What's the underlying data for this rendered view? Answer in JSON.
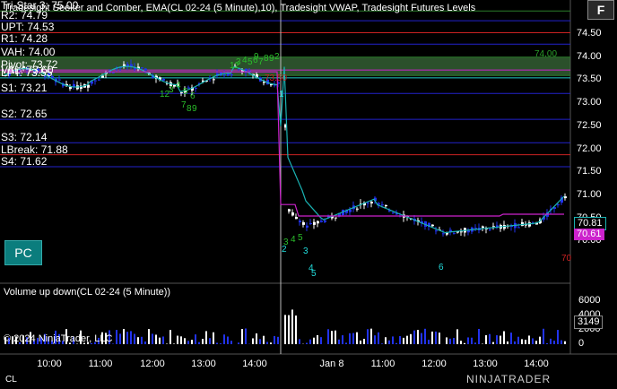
{
  "legend": "Tradesight Seeker and Comber, EMA(CL 02-24 (5 Minute),10), Tradesight VWAP, Tradesight Futures Levels",
  "levels": [
    {
      "label": "Tri-Star 3: 75.00",
      "price": 75.0,
      "color": "#2a7d2a"
    },
    {
      "label": "R2: 74.79",
      "price": 74.79,
      "color": "#2222cc"
    },
    {
      "label": "UPT: 74.53",
      "price": 74.53,
      "color": "#cc2222"
    },
    {
      "label": "R1: 74.28",
      "price": 74.28,
      "color": "#2222cc"
    },
    {
      "label": "VAH: 74.00",
      "price": 74.0,
      "color": "#2a7d2a"
    },
    {
      "label": "Pivot: 73.72",
      "price": 73.72,
      "color": "#cc22cc"
    },
    {
      "label": "VAL: 73.60",
      "price": 73.6,
      "color": "#2a7d2a"
    },
    {
      "label": "LPT: 73.55",
      "price": 73.55,
      "color": "#22cccc"
    },
    {
      "label": "S1: 73.21",
      "price": 73.21,
      "color": "#2222cc"
    },
    {
      "label": "S2: 72.65",
      "price": 72.65,
      "color": "#2222cc"
    },
    {
      "label": "S3: 72.14",
      "price": 72.14,
      "color": "#2222cc"
    },
    {
      "label": "LBreak: 71.88",
      "price": 71.88,
      "color": "#cc2222"
    },
    {
      "label": "S4: 71.62",
      "price": 71.62,
      "color": "#2222cc"
    }
  ],
  "price_axis": [
    "74.50",
    "74.00",
    "73.50",
    "73.00",
    "72.50",
    "72.00",
    "71.50",
    "71.00",
    "70.50",
    "70.00"
  ],
  "vol_axis": [
    "6000",
    "4000",
    "2000",
    "0"
  ],
  "time_axis": [
    "10:00",
    "11:00",
    "12:00",
    "13:00",
    "14:00",
    "Jan 8",
    "11:00",
    "12:00",
    "13:00",
    "14:00"
  ],
  "volume_title": "Volume up down(CL 02-24 (5 Minute))",
  "copyright": "© 2024 NinjaTrader, LLC",
  "pc_button": "PC",
  "f_button": "F",
  "badges": {
    "ema": "70.81",
    "vwap": "70.61",
    "volume": "3149",
    "right_red": "70",
    "vah_right": "74.00",
    "mid_red": "73.50"
  },
  "instrument": "CL",
  "brand": "NINJATRADER",
  "colors": {
    "background": "#000000",
    "ema": "#1ab3b3",
    "vwap": "#cc22cc",
    "up_bar": "#ffffff",
    "down_bar": "#2233ee",
    "value_area": "#3a6b3a"
  },
  "counts": {
    "green": [
      "9",
      "12",
      "3",
      "4",
      "5",
      "6",
      "7",
      "8",
      "9",
      "12",
      "3",
      "4",
      "5",
      "6",
      "7",
      "8",
      "9",
      "2",
      "3",
      "4",
      "5"
    ],
    "cyan": [
      "1",
      "2",
      "3",
      "4",
      "5",
      "6"
    ]
  }
}
